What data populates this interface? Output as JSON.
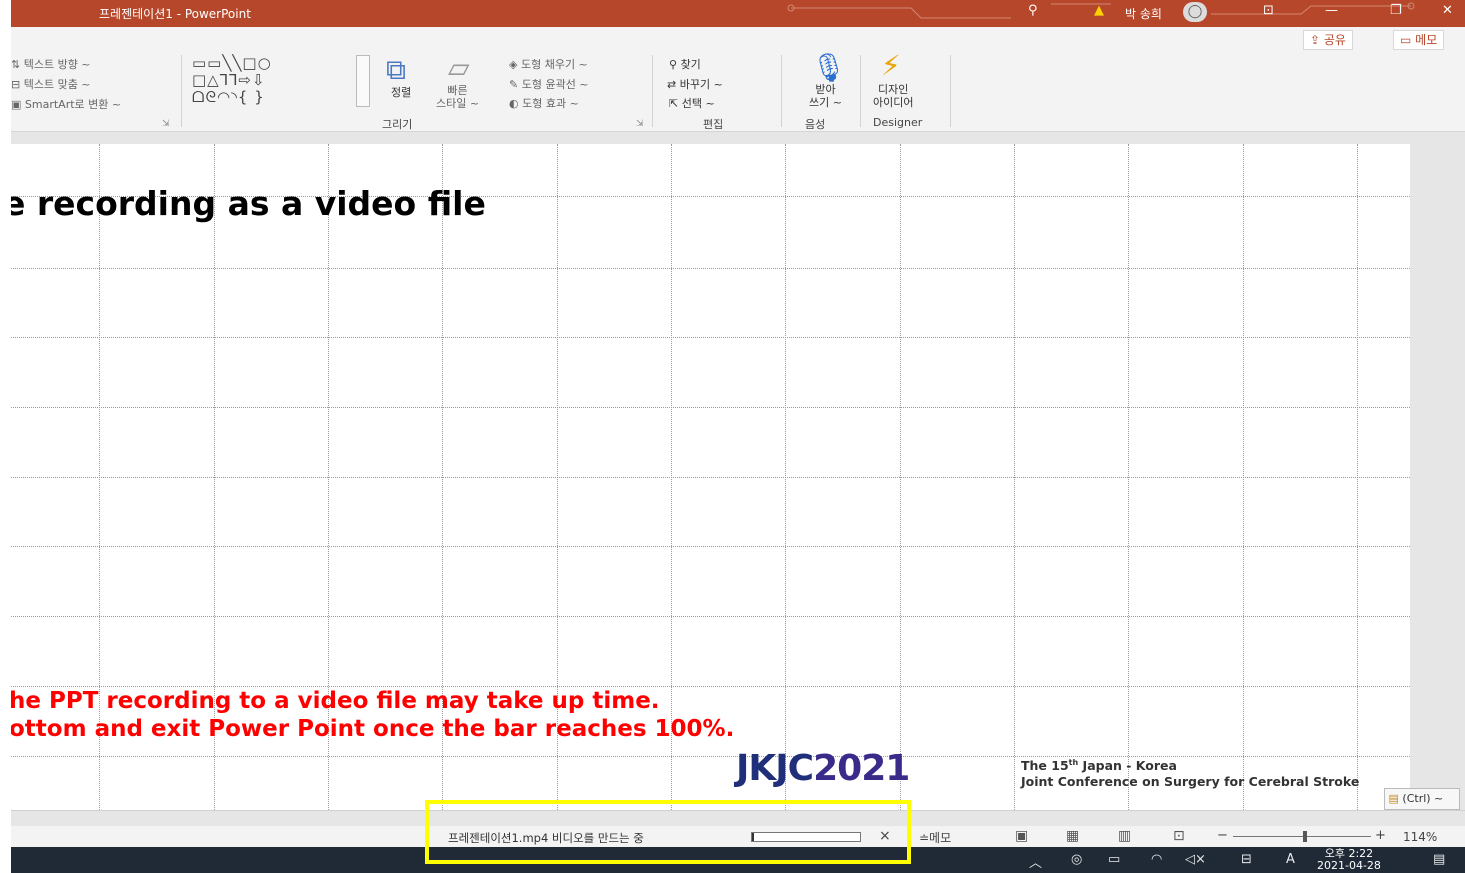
{
  "window": {
    "title": "프레젠테이션1  -  PowerPoint",
    "user_name": "박 송희",
    "share_label": "공유",
    "memo_label": "메모"
  },
  "ribbon": {
    "text_direction": "텍스트 방향 ~",
    "text_align": "텍스트 맞춤 ~",
    "smartart": "SmartArt로 변환 ~",
    "shapes_rows": [
      "▭▭╲╲□○",
      "□△⅂⅂⇨⇩",
      "ᗝᘓ◠◝{ }"
    ],
    "arrange": "정렬",
    "quick_styles": "빠른\n스타일 ~",
    "shape_fill": "도형 채우기 ~",
    "shape_outline": "도형 윤곽선 ~",
    "shape_effects": "도형 효과 ~",
    "find": "찾기",
    "replace": "바꾸기  ~",
    "select": "선택 ~",
    "dictate_line1": "받아",
    "dictate_line2": "쓰기 ~",
    "design_line1": "디자인",
    "design_line2": "아이디어",
    "groups": {
      "drawing": "그리기",
      "editing": "편집",
      "voice": "음성",
      "designer": "Designer"
    }
  },
  "slide": {
    "title": "e recording as a video file",
    "note_line1": "he PPT recording to a video file may take up time.",
    "note_line2": "ottom and exit Power Point once the bar reaches 100%.",
    "logo_main": "JKJC",
    "logo_year": "2021",
    "logo_line1_pre": "The 15",
    "logo_line1_sup": "th",
    "logo_line1_post": " Japan - Korea",
    "logo_line2": "Joint Conference on Surgery for Cerebral Stroke",
    "paste_options": "(Ctrl) ~"
  },
  "status": {
    "progress_text": "프레젠테이션1.mp4 비디오를 만드는 중",
    "progress_fraction": 0.02,
    "cancel": "×",
    "memo": "≐메모",
    "zoom_minus": "−",
    "zoom_plus": "+",
    "zoom": "114%"
  },
  "taskbar": {
    "time": "오후 2:22",
    "date": "2021-04-28",
    "ime": "A"
  },
  "colors": {
    "titlebar": "#b7472a",
    "note_text": "#ff0000",
    "logo": "#1f2f7a",
    "highlight": "#ffff00"
  }
}
